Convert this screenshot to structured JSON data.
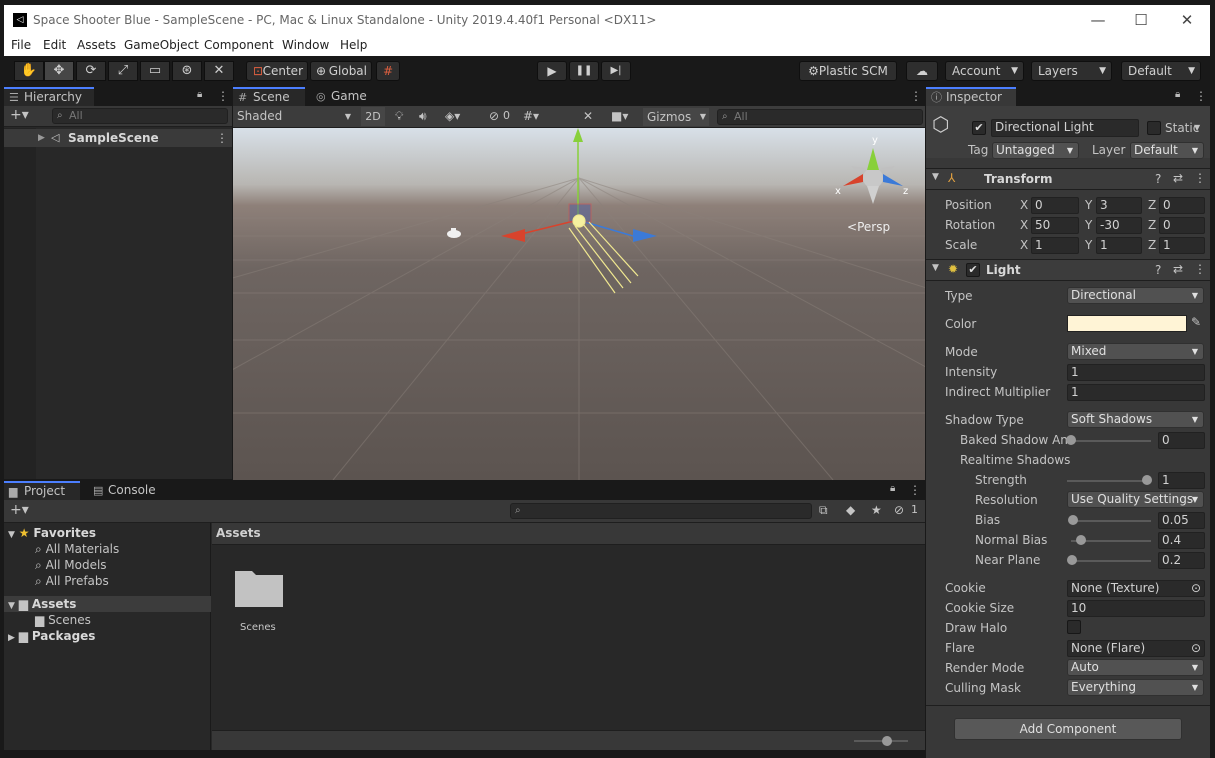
{
  "window": {
    "title": "Space Shooter Blue - SampleScene - PC, Mac & Linux Standalone - Unity 2019.4.40f1 Personal <DX11>",
    "minimize": "—",
    "maximize": "☐",
    "close": "✕"
  },
  "menu": [
    "File",
    "Edit",
    "Assets",
    "GameObject",
    "Component",
    "Window",
    "Help"
  ],
  "toolbar": {
    "pivot": "Center",
    "space": "Global",
    "plastic": "Plastic SCM",
    "account": "Account",
    "layers": "Layers",
    "layout": "Default"
  },
  "hierarchy": {
    "tab": "Hierarchy",
    "search_placeholder": "All",
    "scene": "SampleScene"
  },
  "scene": {
    "tab_scene": "Scene",
    "tab_game": "Game",
    "shading": "Shaded",
    "mode2d": "2D",
    "hidden_count": "0",
    "gizmos": "Gizmos",
    "search_placeholder": "All",
    "persp": "Persp",
    "axis_x": "x",
    "axis_y": "y",
    "axis_z": "z"
  },
  "inspector": {
    "tab": "Inspector",
    "object_name": "Directional Light",
    "static": "Static",
    "tag_label": "Tag",
    "tag_value": "Untagged",
    "layer_label": "Layer",
    "layer_value": "Default",
    "transform": {
      "title": "Transform",
      "position_label": "Position",
      "rotation_label": "Rotation",
      "scale_label": "Scale",
      "position": {
        "x": "0",
        "y": "3",
        "z": "0"
      },
      "rotation": {
        "x": "50",
        "y": "-30",
        "z": "0"
      },
      "scale": {
        "x": "1",
        "y": "1",
        "z": "1"
      }
    },
    "light": {
      "title": "Light",
      "type_label": "Type",
      "type_value": "Directional",
      "color_label": "Color",
      "color_value": "#fff4d6",
      "mode_label": "Mode",
      "mode_value": "Mixed",
      "intensity_label": "Intensity",
      "intensity_value": "1",
      "indirect_label": "Indirect Multiplier",
      "indirect_value": "1",
      "shadow_type_label": "Shadow Type",
      "shadow_type_value": "Soft Shadows",
      "baked_label": "Baked Shadow An",
      "baked_value": "0",
      "baked_level": 0,
      "realtime_label": "Realtime Shadows",
      "strength_label": "Strength",
      "strength_value": "1",
      "strength_level": 1,
      "resolution_label": "Resolution",
      "resolution_value": "Use Quality Settings",
      "bias_label": "Bias",
      "bias_value": "0.05",
      "bias_level": 0.025,
      "normal_bias_label": "Normal Bias",
      "normal_bias_value": "0.4",
      "normal_bias_level": 0.13,
      "near_plane_label": "Near Plane",
      "near_plane_value": "0.2",
      "near_plane_level": 0.01,
      "cookie_label": "Cookie",
      "cookie_value": "None (Texture)",
      "cookie_size_label": "Cookie Size",
      "cookie_size_value": "10",
      "draw_halo_label": "Draw Halo",
      "flare_label": "Flare",
      "flare_value": "None (Flare)",
      "render_mode_label": "Render Mode",
      "render_mode_value": "Auto",
      "culling_label": "Culling Mask",
      "culling_value": "Everything"
    },
    "add_component": "Add Component"
  },
  "project": {
    "tab_project": "Project",
    "tab_console": "Console",
    "hidden_count": "1",
    "favorites": "Favorites",
    "fav_items": [
      "All Materials",
      "All Models",
      "All Prefabs"
    ],
    "assets": "Assets",
    "scenes": "Scenes",
    "packages": "Packages",
    "breadcrumb": "Assets",
    "folder_label": "Scenes"
  },
  "colors": {
    "accent": "#4c7fff",
    "x_axis": "#d8432c",
    "y_axis": "#88d03a",
    "z_axis": "#3b7ad8"
  }
}
